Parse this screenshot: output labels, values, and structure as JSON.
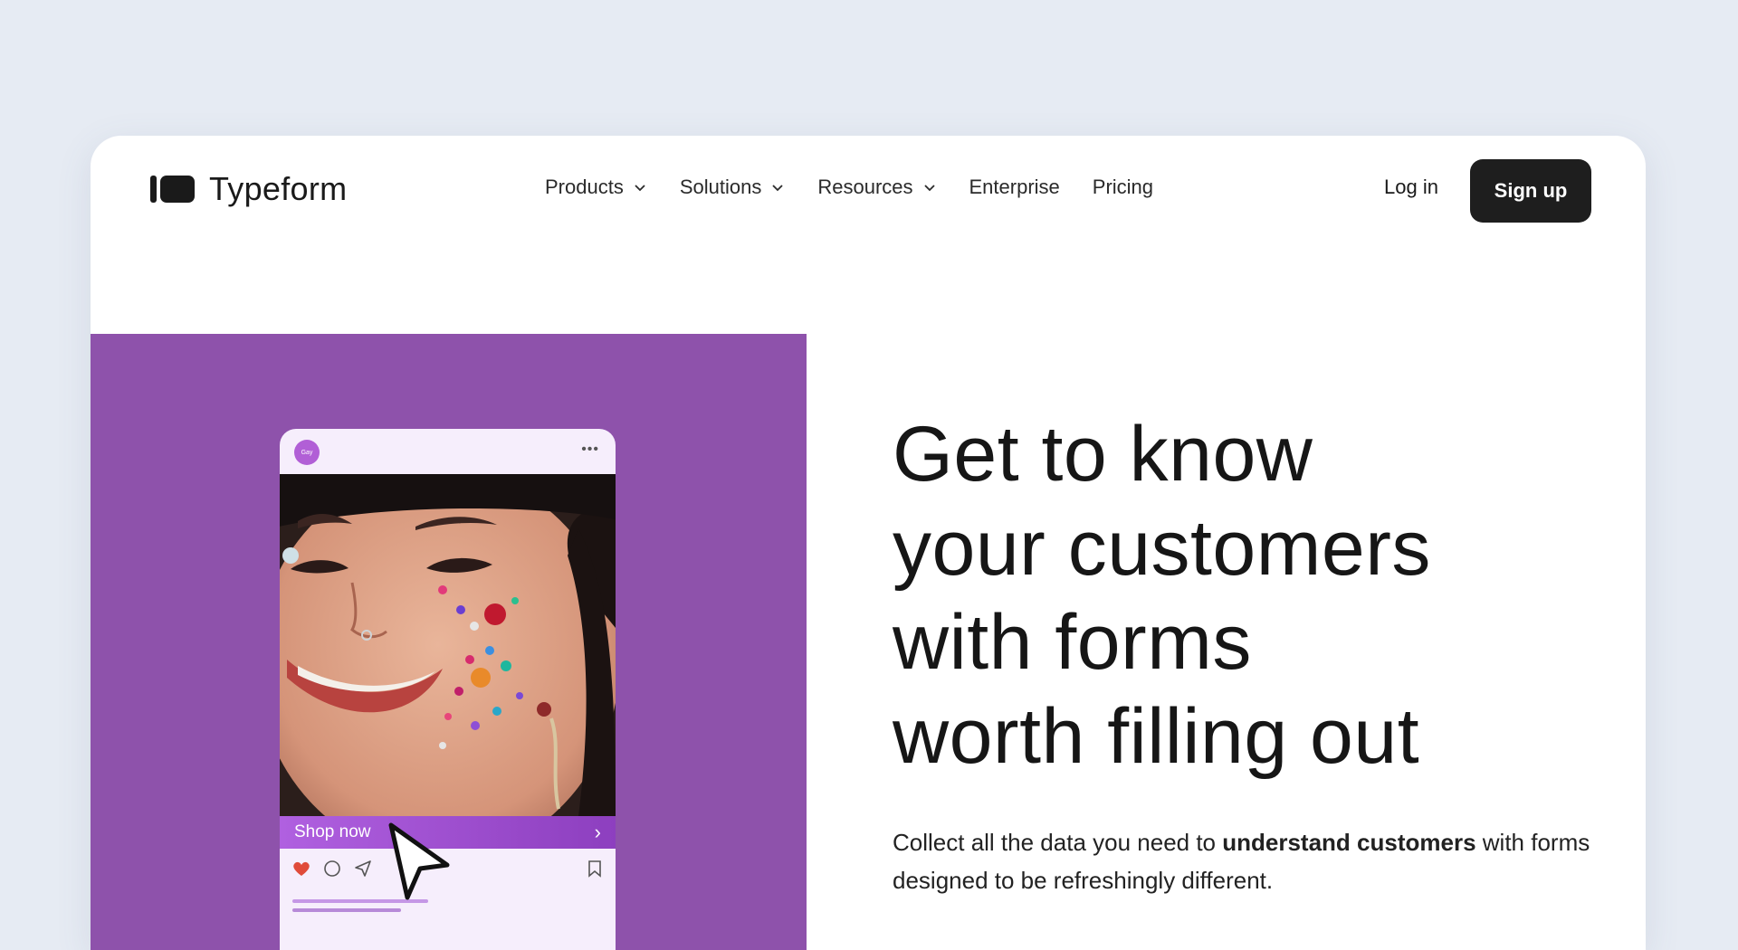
{
  "brand": {
    "name": "Typeform"
  },
  "nav": {
    "items": [
      {
        "label": "Products",
        "dropdown": true
      },
      {
        "label": "Solutions",
        "dropdown": true
      },
      {
        "label": "Resources",
        "dropdown": true
      },
      {
        "label": "Enterprise",
        "dropdown": false
      },
      {
        "label": "Pricing",
        "dropdown": false
      }
    ],
    "login_label": "Log in",
    "signup_label": "Sign up"
  },
  "promo": {
    "background_color": "#8e52ab",
    "avatar_text": "Gay",
    "menu_icon": "more-dots-icon",
    "shop_label": "Shop now",
    "action_icons": [
      "heart-icon",
      "comment-icon",
      "share-icon",
      "bookmark-icon"
    ]
  },
  "hero": {
    "title_lines": [
      "Get to know",
      "your customers",
      "with forms",
      "worth filling out"
    ],
    "subtitle_before": "Collect all the data you need to ",
    "subtitle_bold": "understand customers",
    "subtitle_after": " with forms designed to be refreshingly different."
  },
  "colors": {
    "accent": "#8e52ab",
    "button": "#1e1e1e",
    "page_bg": "#e6ebf3"
  }
}
